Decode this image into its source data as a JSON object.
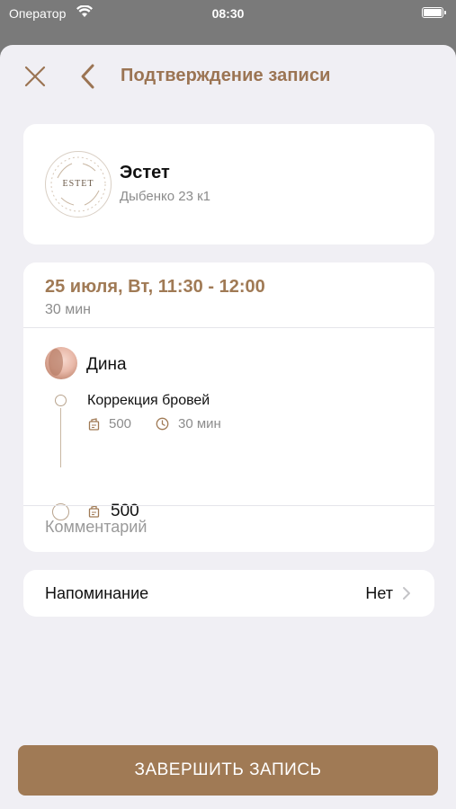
{
  "status_bar": {
    "carrier": "Оператор",
    "time": "08:30"
  },
  "header": {
    "title": "Подтверждение записи",
    "close_icon": "close-icon",
    "back_icon": "chevron-left-icon"
  },
  "salon": {
    "logo_text": "ESTET",
    "name": "Эстет",
    "address": "Дыбенко 23 к1"
  },
  "booking": {
    "datetime": "25 июля, Вт, 11:30 - 12:00",
    "duration": "30 мин",
    "master": {
      "name": "Дина"
    },
    "service": {
      "name": "Коррекция бровей",
      "price": "500",
      "duration": "30 мин"
    },
    "total": "500",
    "comment_placeholder": "Комментарий"
  },
  "reminder": {
    "label": "Напоминание",
    "value": "Нет"
  },
  "finish_button": {
    "label": "ЗАВЕРШИТЬ ЗАПИСЬ"
  },
  "colors": {
    "accent": "#a07a55",
    "background": "#f0eff4",
    "card": "#ffffff",
    "secondary_text": "#8c8c8c"
  }
}
